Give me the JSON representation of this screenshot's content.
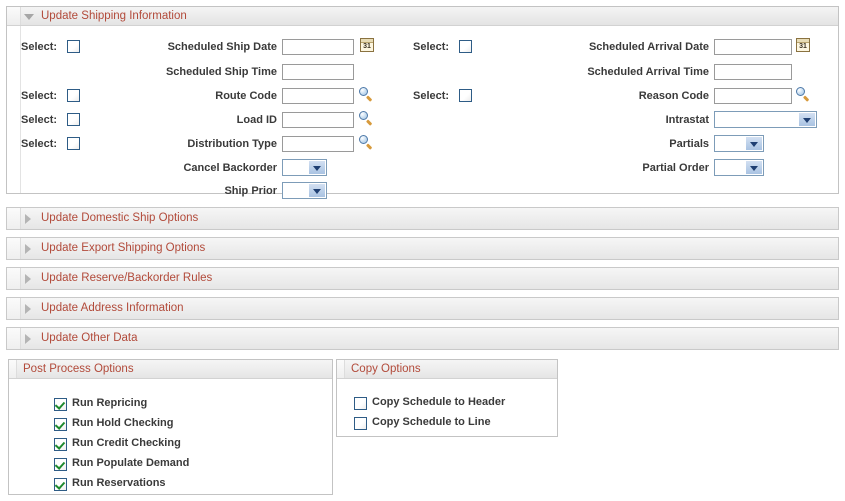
{
  "colors": {
    "section_title": "#b24a3a",
    "label_text": "#3a3a3a",
    "checkbox_border": "#2e5c86",
    "check_mark": "#1e8a2e",
    "panel_border": "#c3c3c3"
  },
  "shipping_group": {
    "title": "Update Shipping Information",
    "expanded": true,
    "toggle_icon": "triangle-down-icon",
    "left_column": [
      {
        "select_label": "Select:",
        "select_checked": false,
        "field_label": "Scheduled Ship Date",
        "value": "",
        "control": "text",
        "trailing_icon": "calendar-icon",
        "calendar_day": "31"
      },
      {
        "select_label": "",
        "select_checked": null,
        "field_label": "Scheduled Ship Time",
        "value": "",
        "control": "text",
        "trailing_icon": ""
      },
      {
        "select_label": "Select:",
        "select_checked": false,
        "field_label": "Route Code",
        "value": "",
        "control": "text",
        "trailing_icon": "magnifier-icon"
      },
      {
        "select_label": "Select:",
        "select_checked": false,
        "field_label": "Load ID",
        "value": "",
        "control": "text",
        "trailing_icon": "magnifier-icon"
      },
      {
        "select_label": "Select:",
        "select_checked": false,
        "field_label": "Distribution Type",
        "value": "",
        "control": "text",
        "trailing_icon": "magnifier-icon"
      },
      {
        "select_label": "",
        "select_checked": null,
        "field_label": "Cancel Backorder",
        "value": "",
        "control": "dropdown",
        "trailing_icon": ""
      },
      {
        "select_label": "",
        "select_checked": null,
        "field_label": "Ship Prior",
        "value": "",
        "control": "dropdown",
        "trailing_icon": ""
      }
    ],
    "right_column": [
      {
        "select_label": "Select:",
        "select_checked": false,
        "field_label": "Scheduled Arrival Date",
        "value": "",
        "control": "text",
        "trailing_icon": "calendar-icon",
        "calendar_day": "31"
      },
      {
        "select_label": "",
        "select_checked": null,
        "field_label": "Scheduled Arrival Time",
        "value": "",
        "control": "text",
        "trailing_icon": ""
      },
      {
        "select_label": "Select:",
        "select_checked": false,
        "field_label": "Reason Code",
        "value": "",
        "control": "text",
        "trailing_icon": "magnifier-icon"
      },
      {
        "select_label": "",
        "select_checked": null,
        "field_label": "Intrastat",
        "value": "",
        "control": "dropdown-wide",
        "trailing_icon": ""
      },
      {
        "select_label": "",
        "select_checked": null,
        "field_label": "Partials",
        "value": "",
        "control": "dropdown",
        "trailing_icon": ""
      },
      {
        "select_label": "",
        "select_checked": null,
        "field_label": "Partial Order",
        "value": "",
        "control": "dropdown",
        "trailing_icon": ""
      }
    ]
  },
  "collapsed_sections": [
    {
      "title": "Update Domestic Ship Options",
      "toggle_icon": "triangle-right-icon"
    },
    {
      "title": "Update Export Shipping Options",
      "toggle_icon": "triangle-right-icon"
    },
    {
      "title": "Update Reserve/Backorder Rules",
      "toggle_icon": "triangle-right-icon"
    },
    {
      "title": "Update Address Information",
      "toggle_icon": "triangle-right-icon"
    },
    {
      "title": "Update Other Data",
      "toggle_icon": "triangle-right-icon"
    }
  ],
  "post_process_options": {
    "title": "Post Process Options",
    "items": [
      {
        "label": "Run Repricing",
        "checked": true
      },
      {
        "label": "Run Hold Checking",
        "checked": true
      },
      {
        "label": "Run Credit Checking",
        "checked": true
      },
      {
        "label": "Run Populate Demand",
        "checked": true
      },
      {
        "label": "Run Reservations",
        "checked": true
      }
    ]
  },
  "copy_options": {
    "title": "Copy Options",
    "items": [
      {
        "label": "Copy Schedule to Header",
        "checked": false
      },
      {
        "label": "Copy Schedule to Line",
        "checked": false
      }
    ]
  }
}
